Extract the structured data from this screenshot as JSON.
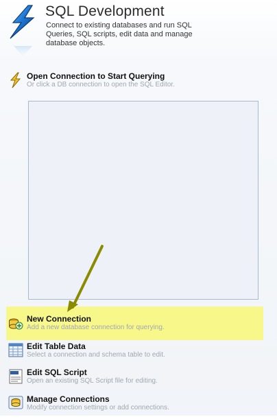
{
  "header": {
    "title": "SQL Development",
    "subtitle": "Connect to existing databases and run SQL Queries, SQL scripts, edit data and manage database objects.",
    "icon": "lightning-icon"
  },
  "open_connection": {
    "title": "Open Connection to Start Querying",
    "description": "Or click a DB connection to open the SQL Editor.",
    "icon": "lightning-icon"
  },
  "actions": [
    {
      "title": "New Connection",
      "description": "Add a new database connection for querying.",
      "icon": "new-connection-icon",
      "highlighted": true
    },
    {
      "title": "Edit Table Data",
      "description": "Select a connection and schema table to edit.",
      "icon": "table-data-icon"
    },
    {
      "title": "Edit SQL Script",
      "description": "Open an existing SQL Script file for editing.",
      "icon": "sql-script-icon"
    },
    {
      "title": "Manage Connections",
      "description": "Modify connection settings or add connections.",
      "icon": "manage-connections-icon"
    }
  ],
  "colors": {
    "highlight": "#f7f78a",
    "arrow": "#8b8b00",
    "panel_border": "#a7b9d4",
    "description_text": "#a1a8b0"
  }
}
